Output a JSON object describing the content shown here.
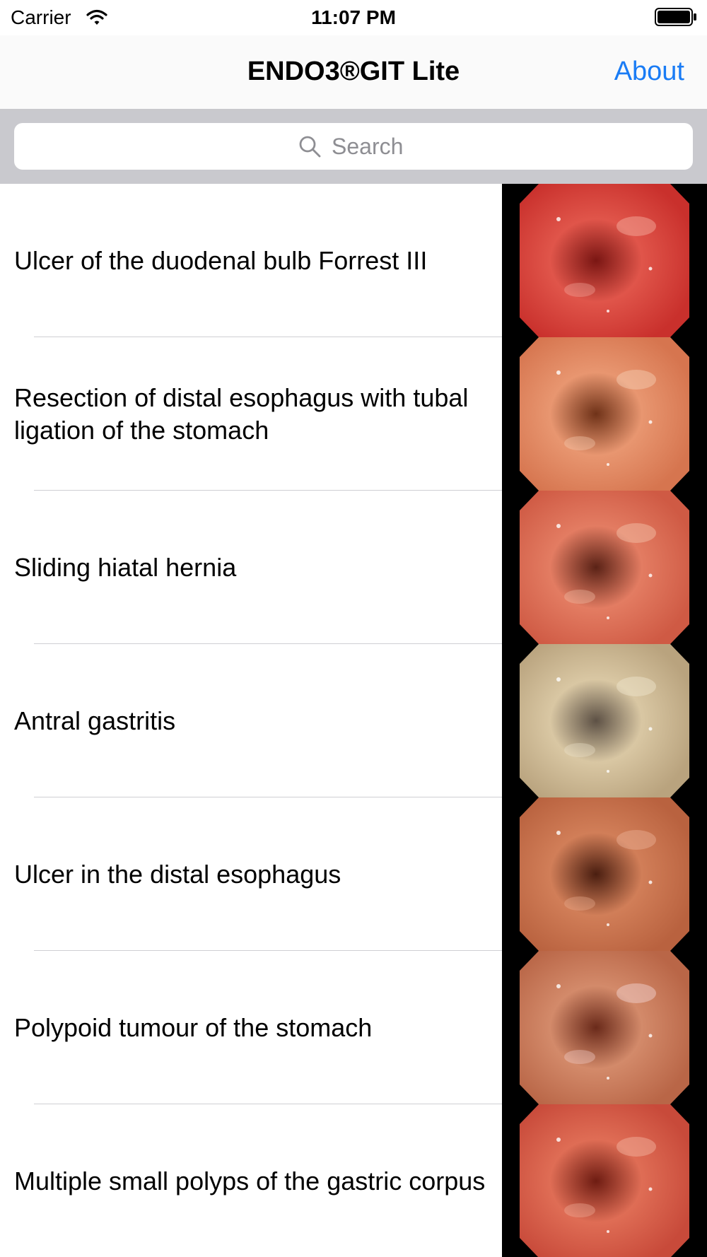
{
  "status_bar": {
    "carrier": "Carrier",
    "time": "11:07 PM"
  },
  "nav": {
    "title": "ENDO3®GIT Lite",
    "about_label": "About"
  },
  "search": {
    "placeholder": "Search",
    "value": ""
  },
  "items": [
    {
      "label": "Ulcer of the duodenal bulb Forrest III",
      "thumb_icon": "endoscopy-image"
    },
    {
      "label": "Resection of distal esophagus with tubal ligation of the stomach",
      "thumb_icon": "endoscopy-image"
    },
    {
      "label": "Sliding hiatal hernia",
      "thumb_icon": "endoscopy-image"
    },
    {
      "label": "Antral gastritis",
      "thumb_icon": "endoscopy-image"
    },
    {
      "label": "Ulcer in the distal esophagus",
      "thumb_icon": "endoscopy-image"
    },
    {
      "label": "Polypoid tumour of the stomach",
      "thumb_icon": "endoscopy-image"
    },
    {
      "label": "Multiple small polyps of the gastric corpus",
      "thumb_icon": "endoscopy-image"
    }
  ],
  "colors": {
    "accent": "#1a7cf5",
    "search_bar_bg": "#c9c9ce",
    "separator": "#cfcfd3"
  }
}
